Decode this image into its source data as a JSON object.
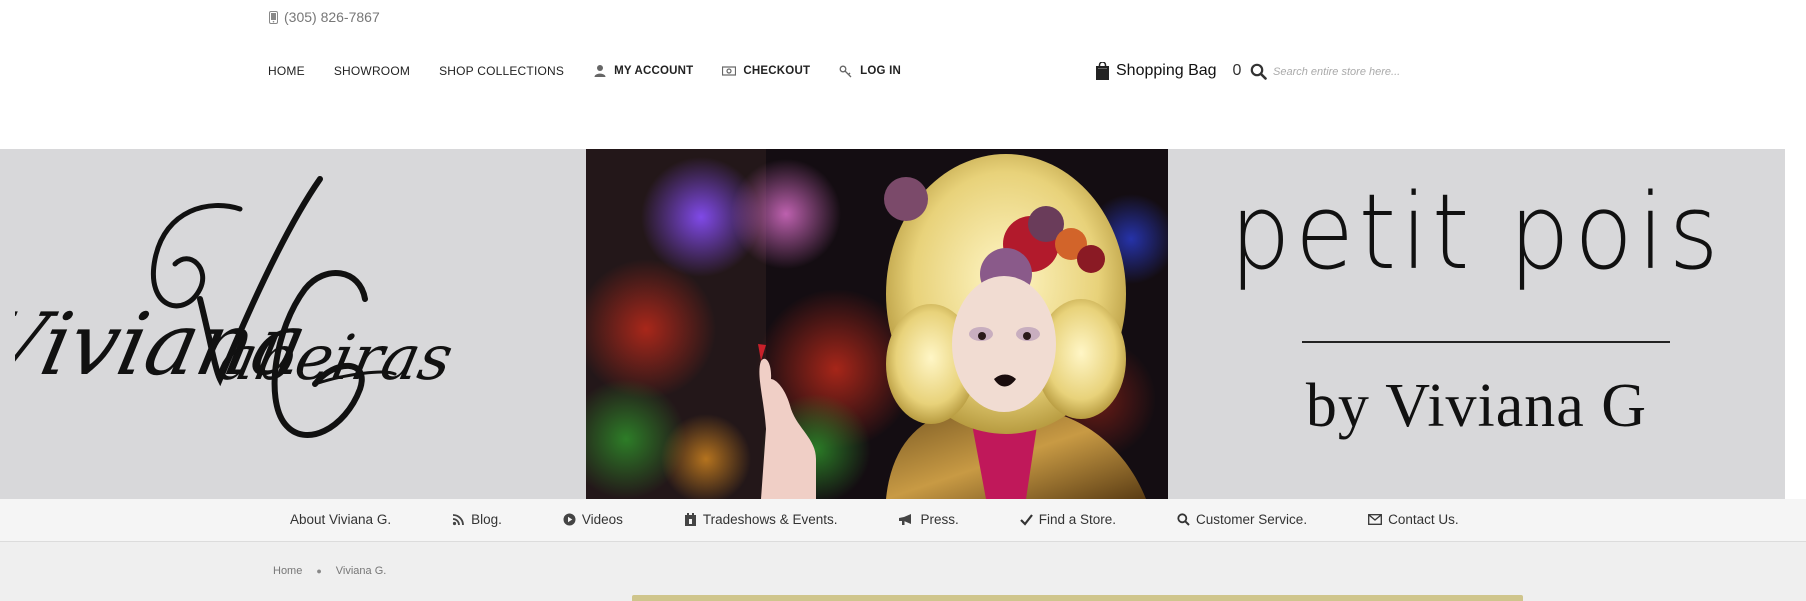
{
  "header": {
    "phone": "(305) 826-7867",
    "nav": [
      {
        "label": "HOME",
        "icon": null
      },
      {
        "label": "SHOWROOM",
        "icon": null
      },
      {
        "label": "SHOP COLLECTIONS",
        "icon": null
      },
      {
        "label": "MY ACCOUNT",
        "icon": "user-icon"
      },
      {
        "label": "CHECKOUT",
        "icon": "money-icon"
      },
      {
        "label": "LOG IN",
        "icon": "key-icon"
      }
    ],
    "bag_label": "Shopping Bag",
    "bag_count": "0",
    "search_placeholder": "Search entire store here..."
  },
  "banner": {
    "logo_text_script": "Viviana Gabeiras",
    "logo_monogram": "VG",
    "brand_title": "petit pois",
    "brand_sub": "by Viviana G"
  },
  "subnav": [
    {
      "label": "About Viviana G.",
      "icon": null
    },
    {
      "label": "Blog.",
      "icon": "rss-icon"
    },
    {
      "label": "Videos",
      "icon": "play-circle-icon"
    },
    {
      "label": "Tradeshows & Events.",
      "icon": "calendar-icon"
    },
    {
      "label": "Press.",
      "icon": "megaphone-icon"
    },
    {
      "label": "Find a Store.",
      "icon": "checkmark-icon"
    },
    {
      "label": "Customer Service.",
      "icon": "search-icon"
    },
    {
      "label": "Contact Us.",
      "icon": "envelope-icon"
    }
  ],
  "breadcrumb": [
    "Home",
    "Viviana G."
  ],
  "colors": {
    "banner_bg": "#d8d8da",
    "subnav_bg": "#f5f5f5",
    "gold_bar": "#cfc58c"
  }
}
